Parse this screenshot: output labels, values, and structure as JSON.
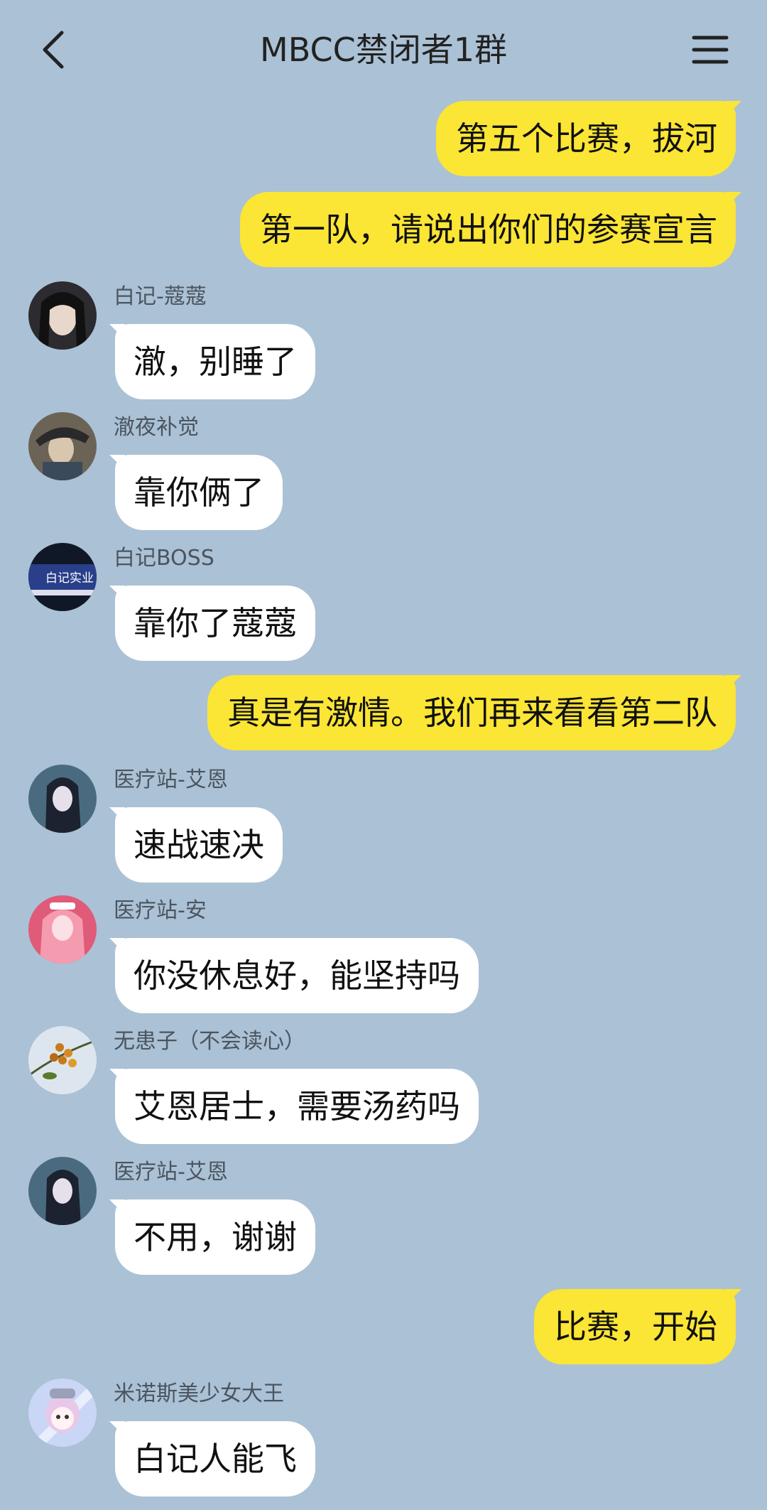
{
  "header": {
    "title": "MBCC禁闭者1群",
    "back_icon": "chevron-left-icon",
    "menu_icon": "hamburger-menu-icon"
  },
  "messages": [
    {
      "side": "right",
      "text": "第五个比赛，拔河"
    },
    {
      "side": "right",
      "text": "第一队，请说出你们的参赛宣言"
    },
    {
      "side": "left",
      "sender": "白记-蔻蔻",
      "text": "澈，别睡了",
      "avatar_color": "#2b2b30"
    },
    {
      "side": "left",
      "sender": "澈夜补觉",
      "text": "靠你俩了",
      "avatar_color": "#5b5448"
    },
    {
      "side": "left",
      "sender": "白记BOSS",
      "text": "靠你了蔻蔻",
      "avatar_color": "#1d2a5a",
      "avatar_text": "白记实业"
    },
    {
      "side": "right",
      "text": "真是有激情。我们再来看看第二队"
    },
    {
      "side": "left",
      "sender": "医疗站-艾恩",
      "text": "速战速决",
      "avatar_color": "#4a6b7f"
    },
    {
      "side": "left",
      "sender": "医疗站-安",
      "text": "你没休息好，能坚持吗",
      "avatar_color": "#e05a7a"
    },
    {
      "side": "left",
      "sender": "无患子（不会读心）",
      "text": "艾恩居士，需要汤药吗",
      "avatar_color": "#dde6ee"
    },
    {
      "side": "left",
      "sender": "医疗站-艾恩",
      "text": "不用，谢谢",
      "avatar_color": "#4a6b7f"
    },
    {
      "side": "right",
      "text": "比赛，开始"
    },
    {
      "side": "left",
      "sender": "米诺斯美少女大王",
      "text": "白记人能飞",
      "avatar_color": "#c9d6f5"
    }
  ]
}
